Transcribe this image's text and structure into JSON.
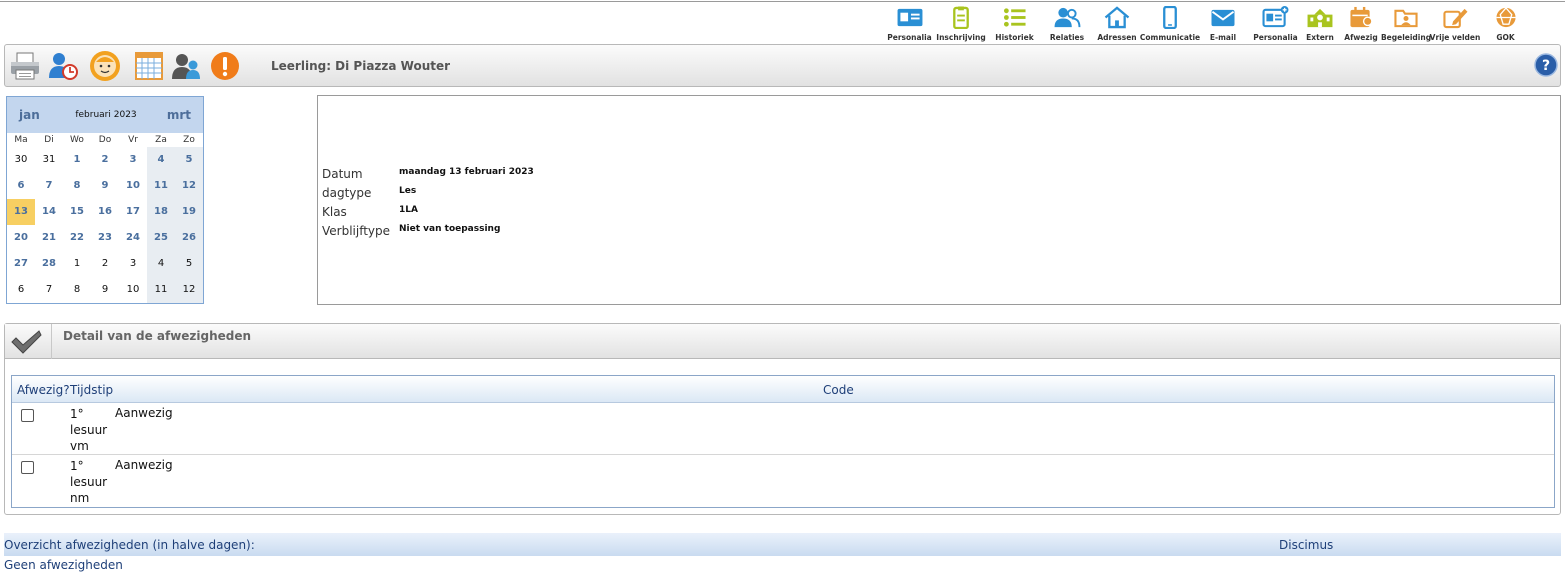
{
  "nav": [
    {
      "label": "Personalia",
      "icon": "id-card-icon",
      "color": "#2a8fd4"
    },
    {
      "label": "Inschrijving",
      "icon": "clipboard-icon",
      "color": "#a9c41f"
    },
    {
      "label": "Historiek",
      "icon": "list-icon",
      "color": "#a9c41f"
    },
    {
      "label": "Relaties",
      "icon": "people-icon",
      "color": "#2a8fd4"
    },
    {
      "label": "Adressen",
      "icon": "house-icon",
      "color": "#2a8fd4"
    },
    {
      "label": "Communicatie",
      "icon": "phone-icon",
      "color": "#2a8fd4"
    },
    {
      "label": "E-mail",
      "icon": "envelope-icon",
      "color": "#2a8fd4"
    },
    {
      "label": "Personalia",
      "icon": "id-card-plus-icon",
      "color": "#2a8fd4"
    },
    {
      "label": "Extern",
      "icon": "school-icon",
      "color": "#a9c41f"
    },
    {
      "label": "Afwezig",
      "icon": "calendar-person-icon",
      "color": "#e89a3a"
    },
    {
      "label": "Begeleiding",
      "icon": "folder-person-icon",
      "color": "#e89a3a"
    },
    {
      "label": "Vrije velden",
      "icon": "edit-icon",
      "color": "#e89a3a"
    },
    {
      "label": "GOK",
      "icon": "globe-icon",
      "color": "#e89a3a"
    }
  ],
  "toolbar": {
    "student_title": "Leerling: Di Piazza Wouter",
    "icons": [
      "printer-icon",
      "user-clock-icon",
      "child-face-icon",
      "calendar-grid-icon",
      "users-icon",
      "warning-icon"
    ],
    "help_icon": "help-icon"
  },
  "calendar": {
    "prev": "jan",
    "month": "februari 2023",
    "next": "mrt",
    "dow": [
      "Ma",
      "Di",
      "Wo",
      "Do",
      "Vr",
      "Za",
      "Zo"
    ],
    "weeks": [
      [
        {
          "d": "30",
          "m": "o"
        },
        {
          "d": "31",
          "m": "o"
        },
        {
          "d": "1",
          "m": "c"
        },
        {
          "d": "2",
          "m": "c"
        },
        {
          "d": "3",
          "m": "c"
        },
        {
          "d": "4",
          "m": "c"
        },
        {
          "d": "5",
          "m": "c"
        }
      ],
      [
        {
          "d": "6",
          "m": "c"
        },
        {
          "d": "7",
          "m": "c"
        },
        {
          "d": "8",
          "m": "c"
        },
        {
          "d": "9",
          "m": "c"
        },
        {
          "d": "10",
          "m": "c"
        },
        {
          "d": "11",
          "m": "c"
        },
        {
          "d": "12",
          "m": "c"
        }
      ],
      [
        {
          "d": "13",
          "m": "c",
          "sel": true
        },
        {
          "d": "14",
          "m": "c"
        },
        {
          "d": "15",
          "m": "c"
        },
        {
          "d": "16",
          "m": "c"
        },
        {
          "d": "17",
          "m": "c"
        },
        {
          "d": "18",
          "m": "c"
        },
        {
          "d": "19",
          "m": "c"
        }
      ],
      [
        {
          "d": "20",
          "m": "c"
        },
        {
          "d": "21",
          "m": "c"
        },
        {
          "d": "22",
          "m": "c"
        },
        {
          "d": "23",
          "m": "c"
        },
        {
          "d": "24",
          "m": "c"
        },
        {
          "d": "25",
          "m": "c"
        },
        {
          "d": "26",
          "m": "c"
        }
      ],
      [
        {
          "d": "27",
          "m": "c"
        },
        {
          "d": "28",
          "m": "c"
        },
        {
          "d": "1",
          "m": "o"
        },
        {
          "d": "2",
          "m": "o"
        },
        {
          "d": "3",
          "m": "o"
        },
        {
          "d": "4",
          "m": "o"
        },
        {
          "d": "5",
          "m": "o"
        }
      ],
      [
        {
          "d": "6",
          "m": "o"
        },
        {
          "d": "7",
          "m": "o"
        },
        {
          "d": "8",
          "m": "o"
        },
        {
          "d": "9",
          "m": "o"
        },
        {
          "d": "10",
          "m": "o"
        },
        {
          "d": "11",
          "m": "o"
        },
        {
          "d": "12",
          "m": "o"
        }
      ]
    ]
  },
  "info": {
    "rows": [
      {
        "label": "Datum",
        "value": "maandag 13 februari 2023"
      },
      {
        "label": "dagtype",
        "value": "Les"
      },
      {
        "label": "Klas",
        "value": "1LA"
      },
      {
        "label": "Verblijftype",
        "value": "Niet van toepassing"
      }
    ]
  },
  "detail": {
    "title": "Detail van de afwezigheden",
    "columns": {
      "absent": "Afwezig?",
      "time": "Tijdstip",
      "code": "Code"
    },
    "rows": [
      {
        "time": "1° lesuur vm",
        "code": "Aanwezig"
      },
      {
        "time": "1° lesuur nm",
        "code": "Aanwezig"
      }
    ]
  },
  "overview": {
    "title": "Overzicht afwezigheden (in halve dagen):",
    "right": "Discimus",
    "empty": "Geen afwezigheden"
  }
}
